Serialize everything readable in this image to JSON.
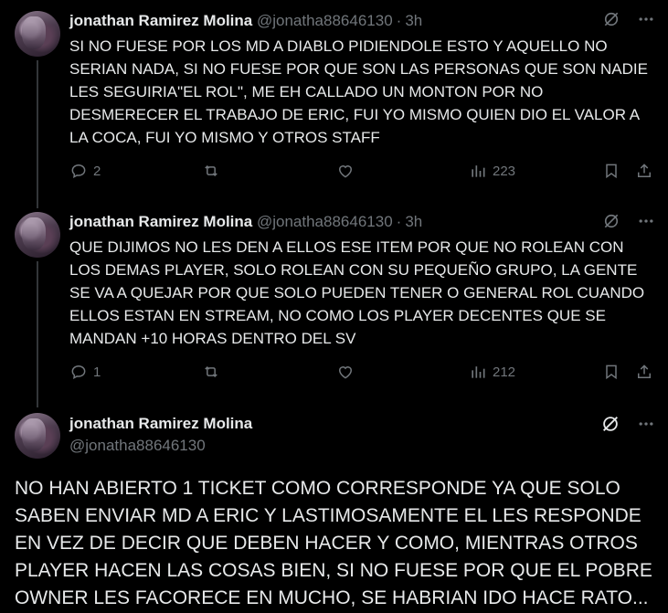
{
  "tweets": [
    {
      "name": "jonathan Ramirez Molina",
      "handle": "@jonatha88646130",
      "time": "3h",
      "text": "SI NO FUESE POR LOS MD A DIABLO PIDIENDOLE ESTO Y AQUELLO NO SERIAN NADA, SI NO FUESE POR QUE SON LAS PERSONAS QUE SON NADIE LES SEGUIRIA\"EL ROL\", ME EH CALLADO UN MONTON POR NO DESMERECER EL TRABAJO DE ERIC, FUI YO MISMO QUIEN DIO EL VALOR A LA COCA, FUI YO MISMO Y OTROS STAFF",
      "replies": "2",
      "views": "223"
    },
    {
      "name": "jonathan Ramirez Molina",
      "handle": "@jonatha88646130",
      "time": "3h",
      "text": "QUE DIJIMOS NO LES DEN A ELLOS ESE ITEM POR QUE NO ROLEAN CON LOS DEMAS PLAYER, SOLO ROLEAN CON SU PEQUEÑO GRUPO, LA GENTE SE VA A QUEJAR POR QUE SOLO PUEDEN TENER O GENERAL ROL CUANDO ELLOS ESTAN EN STREAM, NO COMO LOS PLAYER DECENTES QUE SE MANDAN +10 HORAS DENTRO DEL SV",
      "replies": "1",
      "views": "212"
    }
  ],
  "focal": {
    "name": "jonathan Ramirez Molina",
    "handle": "@jonatha88646130",
    "text": "NO HAN ABIERTO 1 TICKET COMO CORRESPONDE YA QUE SOLO SABEN ENVIAR MD A ERIC Y LASTIMOSAMENTE EL LES RESPONDE EN VEZ DE DECIR QUE DEBEN HACER Y COMO, MIENTRAS OTROS PLAYER HACEN LAS COSAS BIEN, SI NO FUESE POR QUE EL POBRE OWNER LES FACORECE EN MUCHO, SE HABRIAN IDO HACE RATO..."
  },
  "icons": {
    "grok": "grok-icon",
    "more": "more-icon",
    "reply": "reply-icon",
    "retweet": "retweet-icon",
    "like": "like-icon",
    "views": "views-icon",
    "bookmark": "bookmark-icon",
    "share": "share-icon"
  },
  "colors": {
    "background": "#000000",
    "text": "#e7e9ea",
    "muted": "#71767b",
    "thread_line": "#333639"
  }
}
